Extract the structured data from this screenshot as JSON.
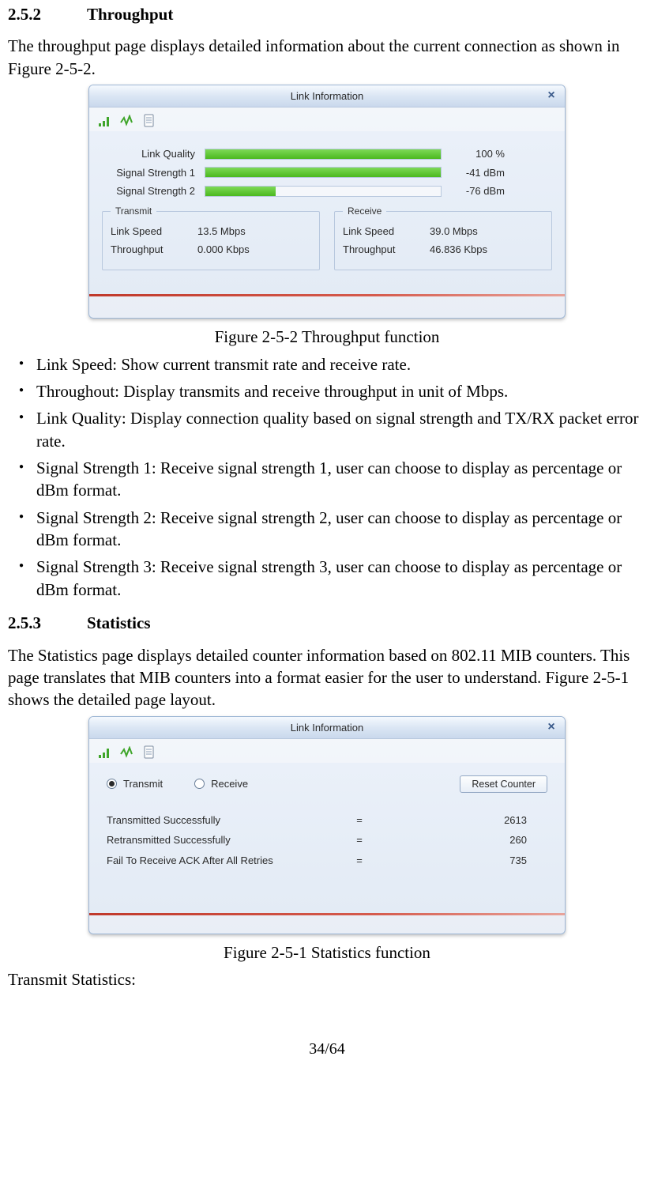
{
  "sections": {
    "s252": {
      "num": "2.5.2",
      "title": "Throughput"
    },
    "s253": {
      "num": "2.5.3",
      "title": "Statistics"
    }
  },
  "para1": "The throughput page displays detailed information about the current connection as shown in Figure 2-5-2.",
  "figureCaption1": "Figure 2-5-2 Throughput function",
  "bullets": [
    "Link Speed: Show current transmit rate and receive rate.",
    "Throughout: Display transmits and receive throughput in unit of Mbps.",
    "Link Quality: Display connection quality based on signal strength and TX/RX packet error rate.",
    "Signal Strength 1: Receive signal strength 1, user can choose to display as percentage or dBm format.",
    "Signal Strength 2: Receive signal strength 2, user can choose to display as percentage or dBm format.",
    "Signal Strength 3: Receive signal strength 3, user can choose to display as percentage or dBm format."
  ],
  "para2": "The Statistics page displays detailed counter information based on 802.11 MIB counters. This page translates that MIB counters into a format easier for the user to understand. Figure 2-5-1 shows the detailed page layout.",
  "figureCaption2": "Figure 2-5-1 Statistics function",
  "para3": "Transmit Statistics:",
  "pageNum": "34/64",
  "panelTitle": "Link Information",
  "throughput": {
    "signals": [
      {
        "label": "Link Quality",
        "value": "100 %",
        "pct": 100
      },
      {
        "label": "Signal Strength 1",
        "value": "-41 dBm",
        "pct": 100
      },
      {
        "label": "Signal Strength 2",
        "value": "-76 dBm",
        "pct": 30
      }
    ],
    "transmit": {
      "legend": "Transmit",
      "linkSpeedLabel": "Link Speed",
      "linkSpeedValue": "13.5 Mbps",
      "throughputLabel": "Throughput",
      "throughputValue": "0.000 Kbps"
    },
    "receive": {
      "legend": "Receive",
      "linkSpeedLabel": "Link Speed",
      "linkSpeedValue": "39.0 Mbps",
      "throughputLabel": "Throughput",
      "throughputValue": "46.836 Kbps"
    }
  },
  "statistics": {
    "radioTransmit": "Transmit",
    "radioReceive": "Receive",
    "resetButton": "Reset Counter",
    "rows": [
      {
        "label": "Transmitted Successfully",
        "value": "2613"
      },
      {
        "label": "Retransmitted Successfully",
        "value": "260"
      },
      {
        "label": "Fail To Receive ACK After All Retries",
        "value": "735"
      }
    ]
  }
}
